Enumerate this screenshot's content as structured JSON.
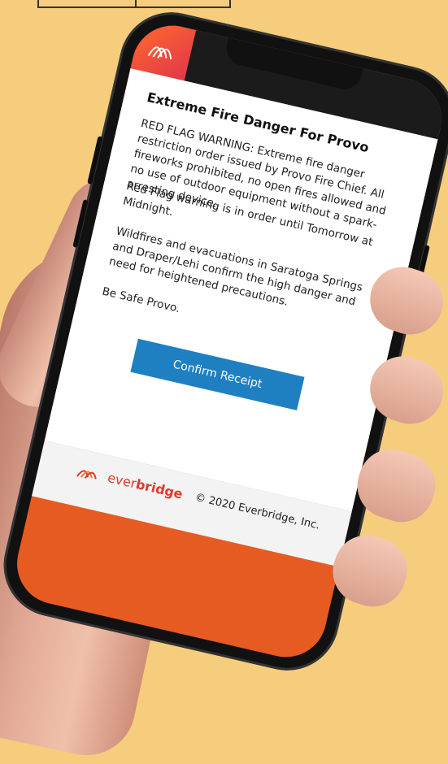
{
  "message": {
    "title": "Extreme Fire Danger For Provo",
    "paragraph1": "RED FLAG WARNING: Extreme fire danger restriction order issued by Provo Fire Chief. All fireworks prohibited, no open fires allowed and no use of outdoor equipment without a spark-arresting device.",
    "paragraph2": "Red Flag warning is in order until Tomorrow at Midnight.",
    "paragraph3": "Wildfires and evacuations in Saratoga Springs and Draper/Lehi confirm the high danger and need for heightened precautions.",
    "paragraph4": "Be Safe Provo.",
    "confirm_label": "Confirm Receipt"
  },
  "footer": {
    "brand_prefix": "ever",
    "brand_suffix": "bridge",
    "copyright": "© 2020 Everbridge, Inc."
  },
  "colors": {
    "background": "#f6cd7d",
    "accent_orange": "#e55b22",
    "button_blue": "#1e7fc1",
    "brand_red": "#e0392f"
  },
  "icons": {
    "app_logo": "everbridge-logo-icon",
    "brand_mark": "everbridge-wave-icon"
  }
}
